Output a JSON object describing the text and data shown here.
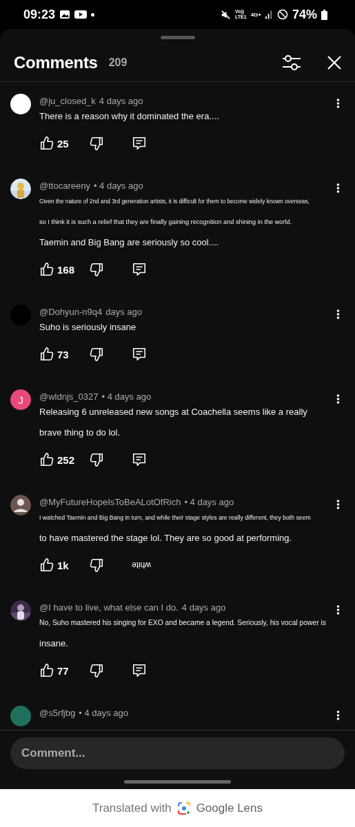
{
  "status_bar": {
    "time": "09:23",
    "volte": "Vo))",
    "lte": "LTE1",
    "network": "4G+",
    "battery": "74%"
  },
  "header": {
    "title": "Comments",
    "count": "209"
  },
  "comments": [
    {
      "author": "@ju_closed_k",
      "time": "4 days ago",
      "avatar": {
        "kind": "plain",
        "color": "#ffffff"
      },
      "lines": [
        "There is a reason why it dominated the era...."
      ],
      "likes": "25"
    },
    {
      "author": "@ttocareeny",
      "time": "• 4 days ago",
      "avatar": {
        "kind": "picture"
      },
      "lines": [
        "Given the nature of 2nd and 3rd generation artists, it is difficult for them to become widely known overseas,",
        "so I think it is such a relief that they are finally gaining recognition and shining in the world.",
        "Taemin and Big Bang are seriously so cool...."
      ],
      "likes": "168"
    },
    {
      "author": "@Dohyun-n9q4",
      "time": "days ago",
      "avatar": {
        "kind": "plain",
        "color": "#000000"
      },
      "lines": [
        "Suho is seriously insane"
      ],
      "likes": "73"
    },
    {
      "author": "@wldnjs_0327",
      "time": "• 4 days ago",
      "avatar": {
        "kind": "letter",
        "letter": "J",
        "color": "#e8487a"
      },
      "lines": [
        "Releasing 6 unreleased new songs at Coachella seems like a really",
        "brave thing to do lol."
      ],
      "likes": "252"
    },
    {
      "author": "@MyFutureHopeIsToBeALotOfRich",
      "time": "• 4 days ago",
      "avatar": {
        "kind": "silhouette"
      },
      "lines": [
        "I watched Taemin and Big Bang in turn, and while their stage styles are really different, they both seem",
        "to have mastered the stage lol. They are so good at performing."
      ],
      "likes": "1k",
      "reply_label": "white"
    },
    {
      "author": "@I have to live, what else can I do.",
      "time": "4 days ago",
      "avatar": {
        "kind": "picture"
      },
      "lines": [
        "No, Suho mastered his singing for EXO and became a legend. Seriously, his vocal power is",
        "insane."
      ],
      "likes": "77"
    },
    {
      "author": "@s5rfjbg",
      "time": "• 4 days ago",
      "avatar": {
        "kind": "plain",
        "color": "#1f6f5c"
      }
    }
  ],
  "composer": {
    "placeholder": "Comment..."
  },
  "footer": {
    "prefix": "Translated with",
    "brand": "Google Lens"
  }
}
